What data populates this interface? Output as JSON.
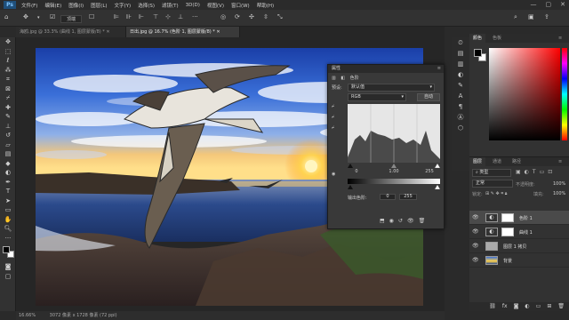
{
  "app": {
    "logo": "Ps"
  },
  "menu": [
    "文件(F)",
    "编辑(E)",
    "图像(I)",
    "图层(L)",
    "文字(Y)",
    "选择(S)",
    "滤镜(T)",
    "3D(D)",
    "视图(V)",
    "窗口(W)",
    "帮助(H)"
  ],
  "window_buttons": [
    "—",
    "▢",
    "✕"
  ],
  "options_bar": {
    "label_top": "顶端"
  },
  "tabs": [
    {
      "label": "海鸥.jpg @ 33.3% (曲线 1, 图层蒙版/8) *"
    },
    {
      "label": "日出.jpg @ 16.7% (色阶 1, 图层蒙版/8) *"
    }
  ],
  "status": {
    "zoom": "16.66%",
    "doc": "3072 像素 x 1728 像素 (72 ppi)"
  },
  "properties": {
    "tab": "属性",
    "type": "色阶",
    "preset_label": "预设:",
    "preset_value": "默认值",
    "channel": "RGB",
    "auto_button": "自动",
    "input_values": [
      "0",
      "1.00",
      "255"
    ],
    "output_label": "输出色阶:",
    "output_values": [
      "0",
      "255"
    ]
  },
  "color_panel": {
    "tabs": [
      "颜色",
      "色板"
    ],
    "fg_color": "#000000",
    "bg_color": "#ffffff"
  },
  "layers_panel": {
    "tabs": [
      "图层",
      "通道",
      "路径"
    ],
    "filter_label": "类型",
    "blend_mode": "正常",
    "opacity_label": "不透明度:",
    "opacity_value": "100%",
    "lock_label": "锁定:",
    "fill_label": "填充:",
    "fill_value": "100%",
    "layers": [
      {
        "name": "色阶 1",
        "selected": true
      },
      {
        "name": "曲线 1",
        "selected": false
      },
      {
        "name": "图层 1 拷贝",
        "selected": false
      },
      {
        "name": "背景",
        "selected": false
      }
    ]
  },
  "colors": {
    "sky": "#3a6fd8",
    "sun": "#ffd24a",
    "sea": "#2b4a8c",
    "accent": "#1f4f7a"
  }
}
